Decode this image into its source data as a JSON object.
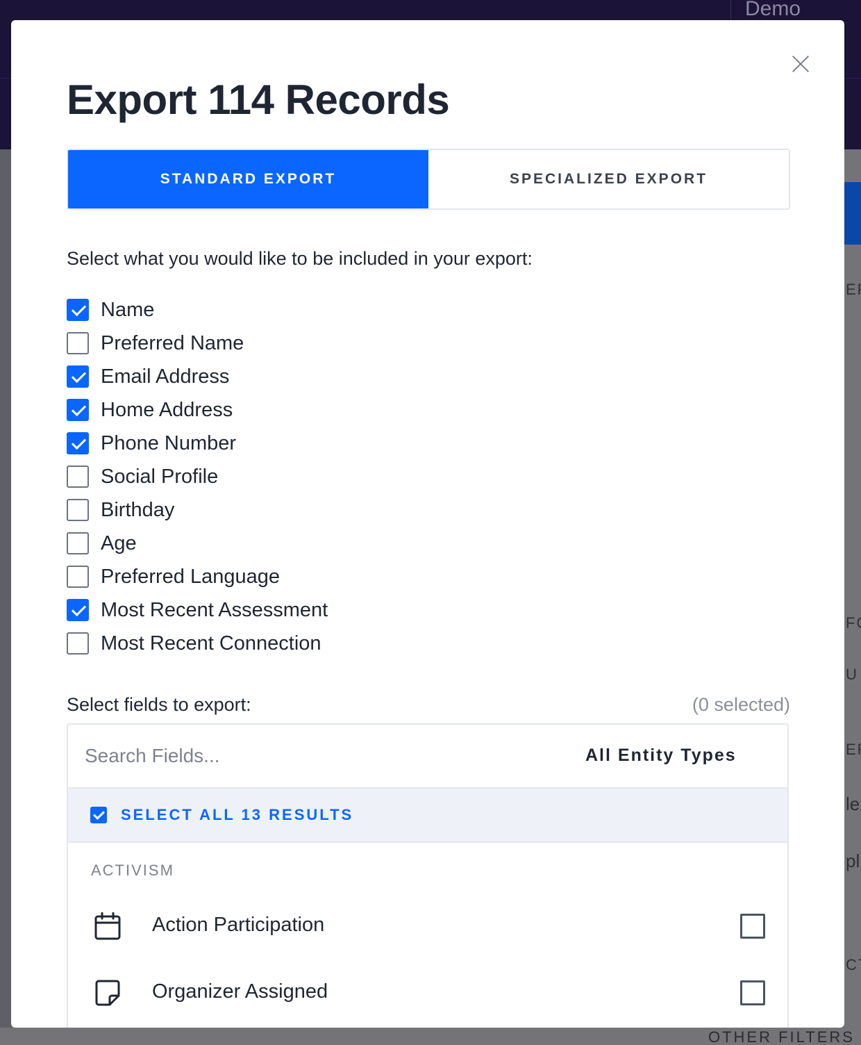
{
  "background": {
    "demo_label": "Demo",
    "other_filters_label": "OTHER FILTERS",
    "edge_fragments": [
      "ERS",
      "FO",
      "U",
      "ER",
      "lex",
      "pl",
      "CT"
    ]
  },
  "modal": {
    "title": "Export 114 Records",
    "close_icon": "close-icon",
    "tabs": [
      {
        "label": "STANDARD EXPORT",
        "active": true
      },
      {
        "label": "SPECIALIZED EXPORT",
        "active": false
      }
    ],
    "prompt": "Select what you would like to be included in your export:",
    "options": [
      {
        "label": "Name",
        "checked": true
      },
      {
        "label": "Preferred Name",
        "checked": false
      },
      {
        "label": "Email Address",
        "checked": true
      },
      {
        "label": "Home Address",
        "checked": true
      },
      {
        "label": "Phone Number",
        "checked": true
      },
      {
        "label": "Social Profile",
        "checked": false
      },
      {
        "label": "Birthday",
        "checked": false
      },
      {
        "label": "Age",
        "checked": false
      },
      {
        "label": "Preferred Language",
        "checked": false
      },
      {
        "label": "Most Recent Assessment",
        "checked": true
      },
      {
        "label": "Most Recent Connection",
        "checked": false
      }
    ],
    "fields_title": "Select fields to export:",
    "fields_count": "(0 selected)",
    "search_placeholder": "Search Fields...",
    "entity_filter": "All Entity Types",
    "select_all_label": "SELECT ALL 13 RESULTS",
    "group_label": "ACTIVISM",
    "fields": [
      {
        "label": "Action Participation",
        "icon": "calendar-icon",
        "checked": false
      },
      {
        "label": "Organizer Assigned",
        "icon": "note-icon",
        "checked": false
      }
    ]
  },
  "colors": {
    "accent": "#0a66ff",
    "header_bg": "#1b1338"
  }
}
